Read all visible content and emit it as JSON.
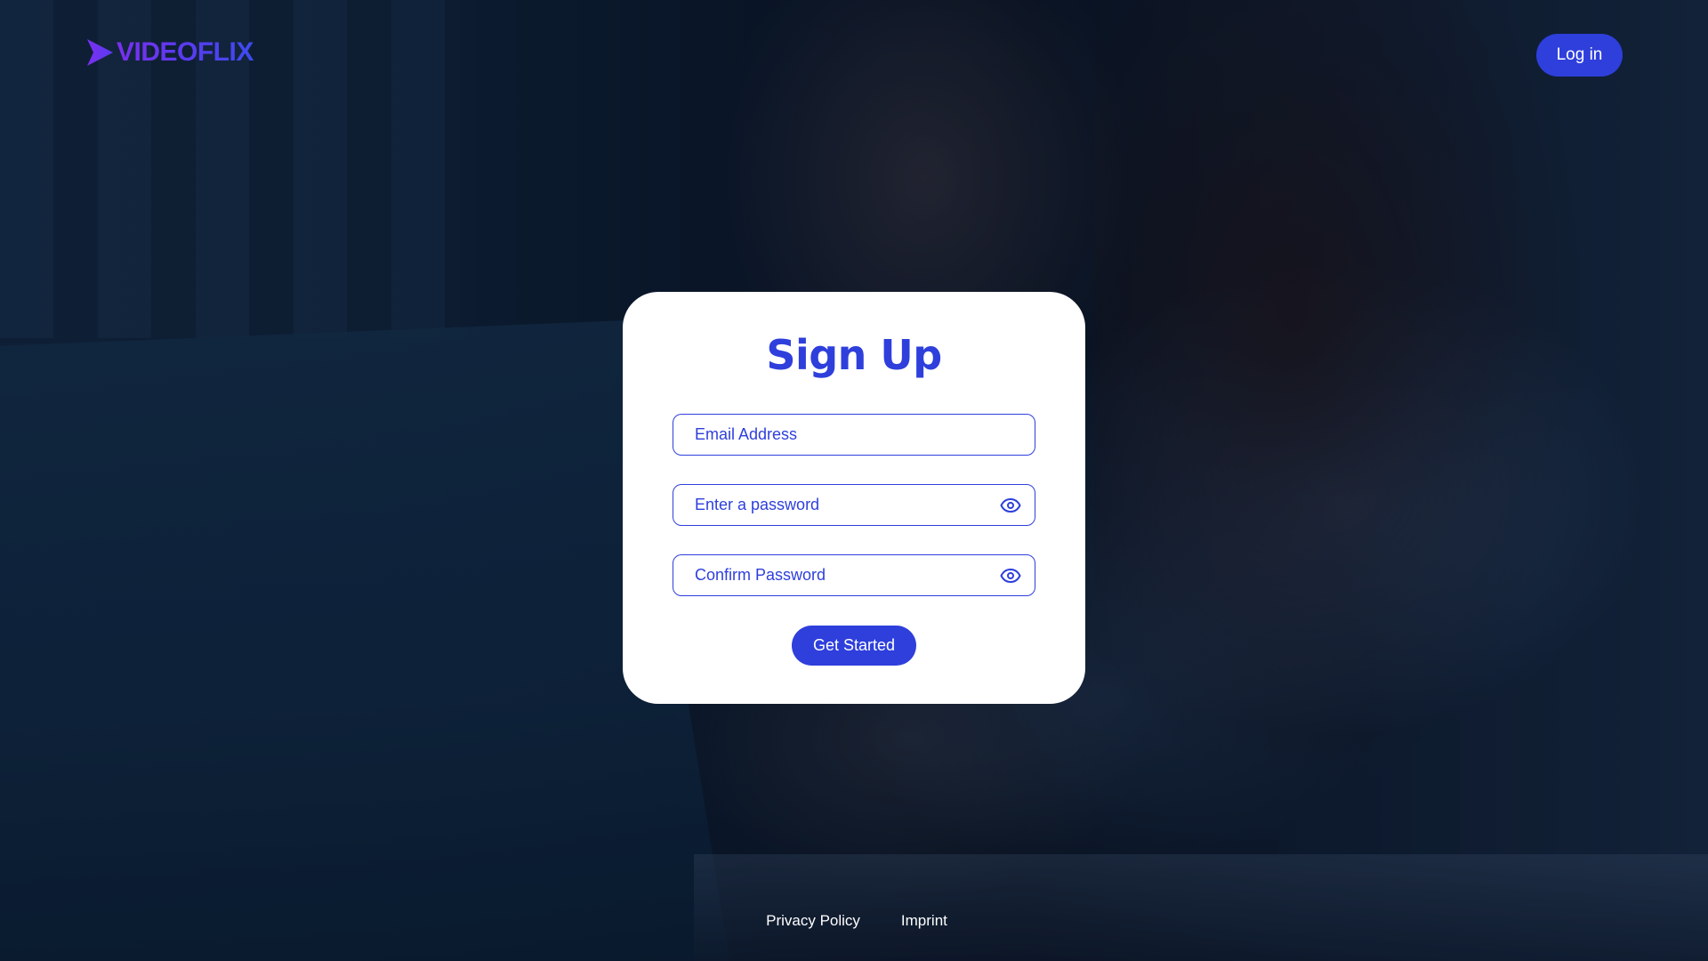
{
  "brand": {
    "name": "VIDEOFLIX",
    "logo_icon": "chevron-play-icon",
    "accent_color": "#2e3fdc",
    "logo_gradient": [
      "#7b2ff0",
      "#3d4bf0"
    ]
  },
  "header": {
    "login_label": "Log in"
  },
  "signup": {
    "title": "Sign Up",
    "email_placeholder": "Email Address",
    "password_placeholder": "Enter a password",
    "confirm_placeholder": "Confirm Password",
    "toggle_icon": "eye-icon",
    "submit_label": "Get Started"
  },
  "footer": {
    "links": [
      {
        "label": "Privacy Policy"
      },
      {
        "label": "Imprint"
      }
    ]
  }
}
